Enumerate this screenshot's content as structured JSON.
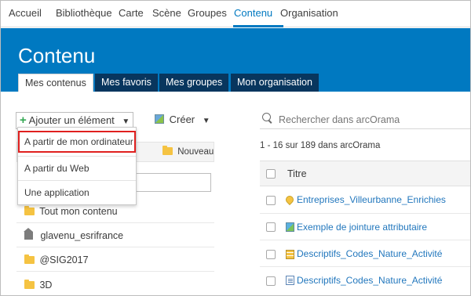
{
  "nav": {
    "items": [
      "Accueil",
      "Bibliothèque",
      "Carte",
      "Scène",
      "Groupes",
      "Contenu",
      "Organisation"
    ],
    "active": "Contenu"
  },
  "page": {
    "title": "Contenu",
    "tabs": [
      "Mes contenus",
      "Mes favoris",
      "Mes groupes",
      "Mon organisation"
    ]
  },
  "toolbar": {
    "add_label": "Ajouter un élément",
    "create_label": "Créer"
  },
  "dropdown": {
    "items": [
      "A partir de mon ordinateur",
      "A partir du Web",
      "Une application"
    ]
  },
  "folders": {
    "new_label": "Nouveau",
    "items": [
      "Tout mon contenu",
      "glavenu_esrifrance",
      "@SIG2017",
      "3D"
    ]
  },
  "search": {
    "placeholder": "Rechercher dans arcOrama",
    "count_text": "1 - 16 sur 189 dans arcOrama"
  },
  "table": {
    "column_title": "Titre",
    "rows": [
      {
        "title": "Entreprises_Villeurbanne_Enrichies",
        "icon": "map-pin-icon"
      },
      {
        "title": "Exemple de jointure attributaire",
        "icon": "web-map-icon"
      },
      {
        "title": "Descriptifs_Codes_Nature_Activité",
        "icon": "table-icon"
      },
      {
        "title": "Descriptifs_Codes_Nature_Activité",
        "icon": "document-icon"
      }
    ]
  },
  "colors": {
    "brand_blue": "#0079c1",
    "tab_dark": "#08365e",
    "highlight_red": "#e0201f",
    "link_blue": "#2277bd"
  }
}
